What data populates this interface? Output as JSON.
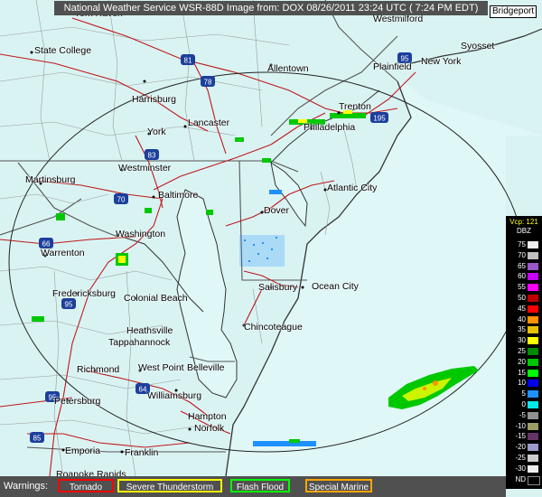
{
  "header": {
    "title": "National Weather Service WSR-88D Image from: DOX 08/26/2011 23:24 UTC ( 7:24 PM EDT)"
  },
  "map": {
    "cities": [
      {
        "id": "york-new-haven",
        "label": "York Haven"
      },
      {
        "id": "westmilford",
        "label": "Westmilford"
      },
      {
        "id": "bridgeport",
        "label": "Bridgeport"
      },
      {
        "id": "state-college",
        "label": "State College"
      },
      {
        "id": "allentown",
        "label": "Allentown"
      },
      {
        "id": "syosset",
        "label": "Syosset"
      },
      {
        "id": "plainfield",
        "label": "Plainfield"
      },
      {
        "id": "new-york",
        "label": "New York"
      },
      {
        "id": "harrisburg",
        "label": "Harrisburg"
      },
      {
        "id": "lancaster",
        "label": "Lancaster"
      },
      {
        "id": "trenton",
        "label": "Trenton"
      },
      {
        "id": "philadelphia",
        "label": "Philadelphia"
      },
      {
        "id": "york",
        "label": "York"
      },
      {
        "id": "westminster",
        "label": "Westminster"
      },
      {
        "id": "martinsburg",
        "label": "Martinsburg"
      },
      {
        "id": "atlantic-city",
        "label": "Atlantic City"
      },
      {
        "id": "baltimore",
        "label": "Baltimore"
      },
      {
        "id": "dover",
        "label": "Dover"
      },
      {
        "id": "washington",
        "label": "Washington"
      },
      {
        "id": "warrenton",
        "label": "Warrenton"
      },
      {
        "id": "salisbury",
        "label": "Salisbury"
      },
      {
        "id": "ocean-city",
        "label": "Ocean City"
      },
      {
        "id": "fredericksburg",
        "label": "Fredericksburg"
      },
      {
        "id": "colonial-beach",
        "label": "Colonial Beach"
      },
      {
        "id": "chincoteague",
        "label": "Chincoteague"
      },
      {
        "id": "heathsville",
        "label": "Heathsville"
      },
      {
        "id": "tappahannock",
        "label": "Tappahannock"
      },
      {
        "id": "richmond",
        "label": "Richmond"
      },
      {
        "id": "west-point",
        "label": "West Point"
      },
      {
        "id": "belleville",
        "label": "Belleville"
      },
      {
        "id": "williamsburg",
        "label": "Williamsburg"
      },
      {
        "id": "petersburg",
        "label": "Petersburg"
      },
      {
        "id": "hampton",
        "label": "Hampton"
      },
      {
        "id": "norfolk",
        "label": "Norfolk"
      },
      {
        "id": "emporia",
        "label": "Emporia"
      },
      {
        "id": "franklin",
        "label": "Franklin"
      },
      {
        "id": "roanoke-rapids",
        "label": "Roanoke Rapids"
      }
    ],
    "highway_shields": [
      {
        "id": "i-81",
        "label": "81"
      },
      {
        "id": "i-78",
        "label": "78"
      },
      {
        "id": "i-83",
        "label": "83"
      },
      {
        "id": "i-70",
        "label": "70"
      },
      {
        "id": "i-66",
        "label": "66"
      },
      {
        "id": "i-95-north",
        "label": "95"
      },
      {
        "id": "i-95-south",
        "label": "95"
      },
      {
        "id": "i-195",
        "label": "195"
      },
      {
        "id": "i-64",
        "label": "64"
      },
      {
        "id": "i-85",
        "label": "85"
      },
      {
        "id": "i-95-nyc",
        "label": "95"
      }
    ]
  },
  "legend": {
    "product": "Vcp: 121",
    "unit": "DBZ",
    "rows": [
      {
        "value": "75",
        "color": "#f0f0f0"
      },
      {
        "value": "70",
        "color": "#c0c0c0"
      },
      {
        "value": "65",
        "color": "#9a55c9"
      },
      {
        "value": "60",
        "color": "#c800ff"
      },
      {
        "value": "55",
        "color": "#ff00ff"
      },
      {
        "value": "50",
        "color": "#c00000"
      },
      {
        "value": "45",
        "color": "#ff0000"
      },
      {
        "value": "40",
        "color": "#ff9000"
      },
      {
        "value": "35",
        "color": "#e8c000"
      },
      {
        "value": "30",
        "color": "#ffff00"
      },
      {
        "value": "25",
        "color": "#008c00"
      },
      {
        "value": "20",
        "color": "#00c800"
      },
      {
        "value": "15",
        "color": "#00ff00"
      },
      {
        "value": "10",
        "color": "#0000f0"
      },
      {
        "value": "5",
        "color": "#1e90ff"
      },
      {
        "value": "0",
        "color": "#04e9e7"
      },
      {
        "value": "-5",
        "color": "#909090"
      },
      {
        "value": "-10",
        "color": "#9c9c64"
      },
      {
        "value": "-15",
        "color": "#663366"
      },
      {
        "value": "-20",
        "color": "#9999cc"
      },
      {
        "value": "-25",
        "color": "#cccccc"
      },
      {
        "value": "-30",
        "color": "#eeeeee"
      },
      {
        "value": "ND",
        "color": "#000000"
      }
    ]
  },
  "warnings": {
    "label": "Warnings:",
    "items": [
      {
        "id": "tornado",
        "label": "Tornado",
        "color": "#ff0000"
      },
      {
        "id": "severe-thunderstorm",
        "label": "Severe Thunderstorm",
        "color": "#ffff00"
      },
      {
        "id": "flash-flood",
        "label": "Flash Flood",
        "color": "#00ff00"
      },
      {
        "id": "special-marine",
        "label": "Special Marine",
        "color": "#ffa500"
      }
    ]
  }
}
